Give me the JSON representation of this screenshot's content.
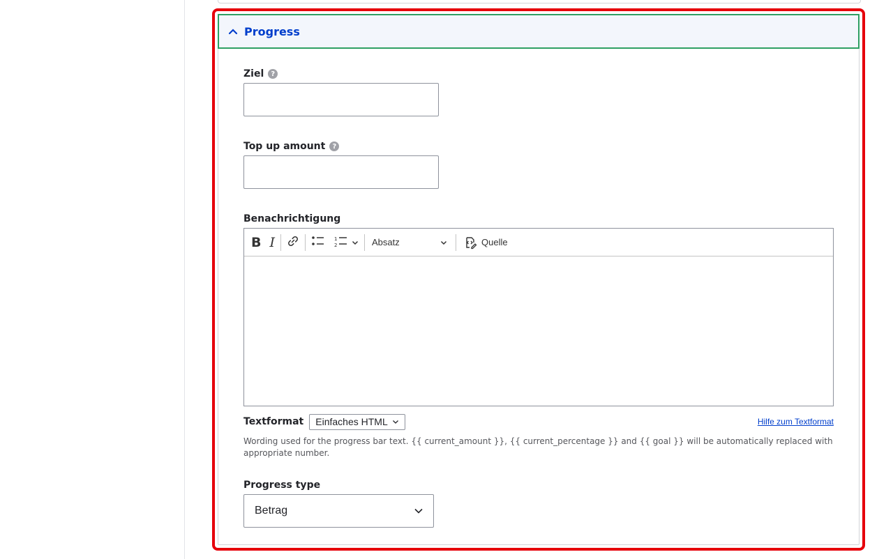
{
  "section": {
    "title": "Progress"
  },
  "fields": {
    "goal": {
      "label": "Ziel",
      "value": ""
    },
    "top_up": {
      "label": "Top up amount",
      "value": ""
    },
    "notification": {
      "label": "Benachrichtigung"
    }
  },
  "editor": {
    "bold_label": "B",
    "italic_label": "I",
    "heading_select": "Absatz",
    "source_label": "Quelle"
  },
  "textformat": {
    "label": "Textformat",
    "selected": "Einfaches HTML",
    "help_link": "Hilfe zum Textformat",
    "description": "Wording used for the progress bar text. {{ current_amount }}, {{ current_percentage }} and {{ goal }} will be automatically replaced with appropriate number."
  },
  "progress_type": {
    "label": "Progress type",
    "selected": "Betrag"
  },
  "colors": {
    "accent_blue": "#003ecc",
    "focus_green": "#2e9f63",
    "highlight_red": "#e6000b"
  }
}
